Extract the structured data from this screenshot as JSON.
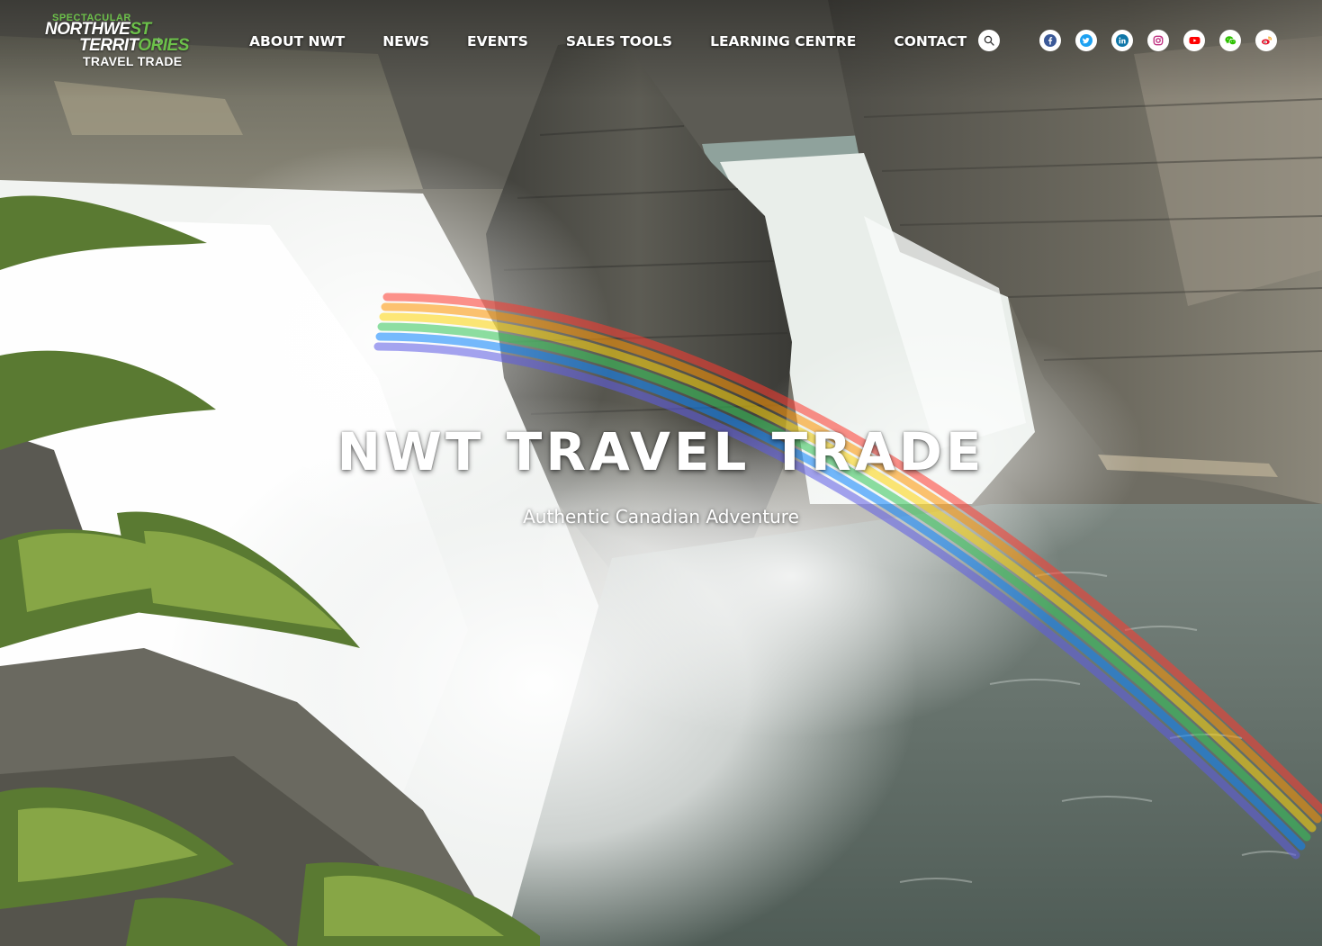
{
  "logo": {
    "tagline": "SPECTACULAR",
    "line1_main": "NORTHWE",
    "line1_accent": "ST",
    "line2_main": "TERRIT",
    "line2_accent": "ORIES",
    "subtitle": "TRAVEL TRADE"
  },
  "nav": {
    "items": [
      {
        "label": "ABOUT NWT"
      },
      {
        "label": "NEWS"
      },
      {
        "label": "EVENTS"
      },
      {
        "label": "SALES TOOLS"
      },
      {
        "label": "LEARNING CENTRE"
      },
      {
        "label": "CONTACT"
      }
    ]
  },
  "header_icons": {
    "search": "search-icon",
    "social": [
      "facebook-icon",
      "twitter-icon",
      "linkedin-icon",
      "instagram-icon",
      "youtube-icon",
      "wechat-icon",
      "weibo-icon"
    ]
  },
  "hero": {
    "title": "NWT TRAVEL TRADE",
    "subtitle": "Authentic Canadian Adventure"
  },
  "colors": {
    "brand_green": "#6cc04a",
    "facebook": "#3b5998",
    "twitter": "#1da1f2",
    "linkedin": "#0e76a8",
    "instagram": "#c13584",
    "youtube": "#ff0000",
    "wechat": "#2dc100",
    "weibo": "#e6162d"
  }
}
